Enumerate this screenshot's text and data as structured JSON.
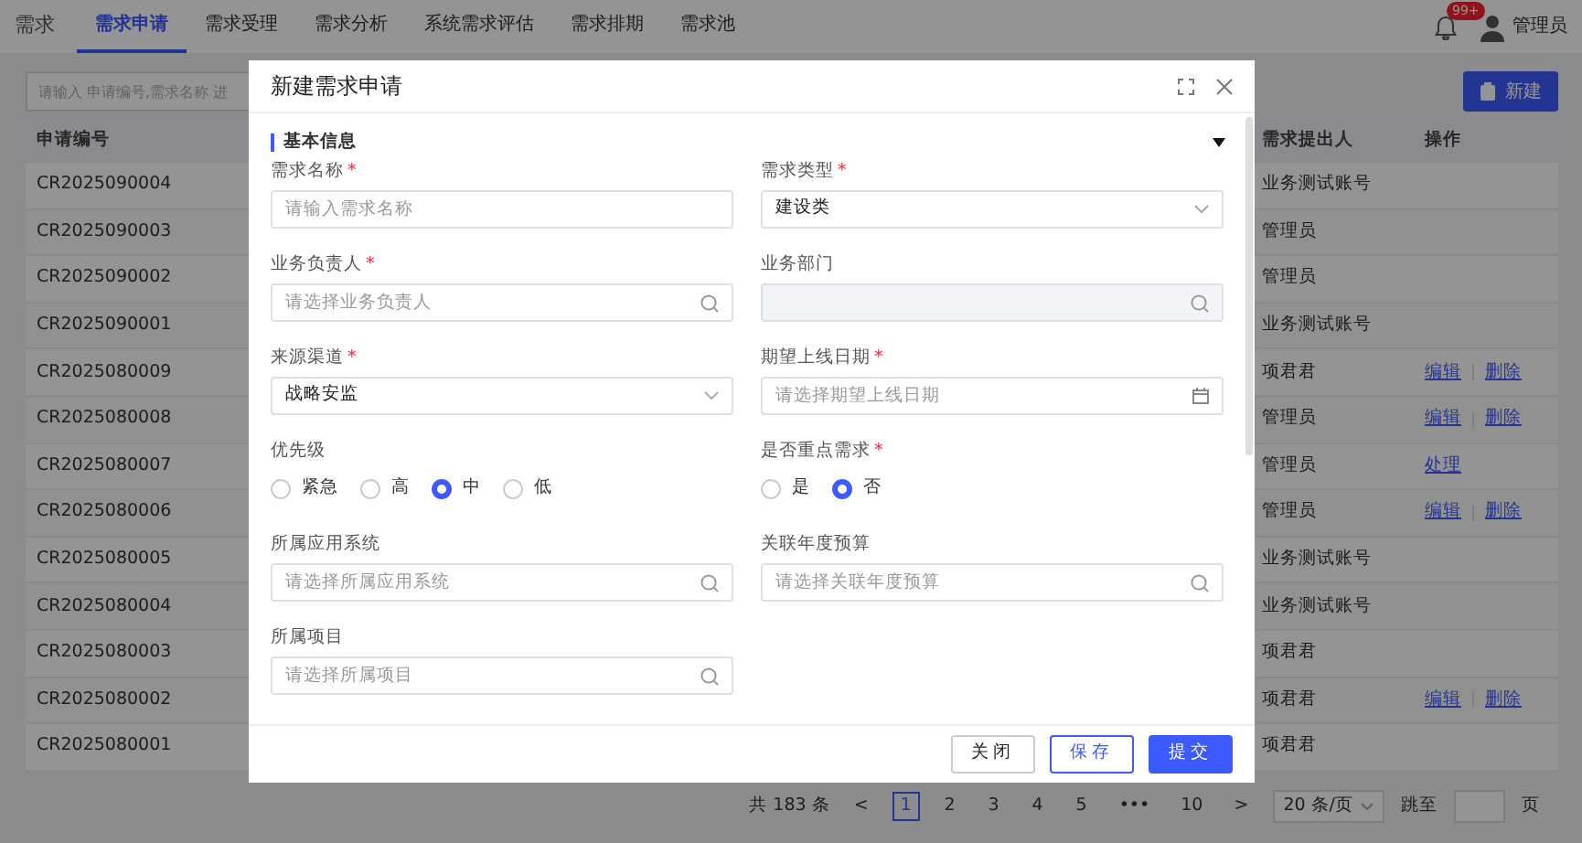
{
  "nav": {
    "brand": "需求",
    "tabs": [
      {
        "label": "需求申请",
        "selected": true
      },
      {
        "label": "需求受理",
        "selected": false
      },
      {
        "label": "需求分析",
        "selected": false
      },
      {
        "label": "系统需求评估",
        "selected": false
      },
      {
        "label": "需求排期",
        "selected": false
      },
      {
        "label": "需求池",
        "selected": false
      }
    ],
    "notification_badge": "99+",
    "user": "管理员"
  },
  "toolbar": {
    "search_placeholder": "请输入 申请编号,需求名称 进",
    "new_button": "新建"
  },
  "table": {
    "columns": [
      "申请编号",
      "需求提出人",
      "操作"
    ],
    "rows": [
      {
        "id": "CR2025090004",
        "proposer": "业务测试账号",
        "actions": []
      },
      {
        "id": "CR2025090003",
        "proposer": "管理员",
        "actions": []
      },
      {
        "id": "CR2025090002",
        "proposer": "管理员",
        "actions": []
      },
      {
        "id": "CR2025090001",
        "proposer": "业务测试账号",
        "actions": []
      },
      {
        "id": "CR2025080009",
        "proposer": "项君君",
        "actions": [
          "编辑",
          "删除"
        ]
      },
      {
        "id": "CR2025080008",
        "proposer": "管理员",
        "actions": [
          "编辑",
          "删除"
        ]
      },
      {
        "id": "CR2025080007",
        "proposer": "管理员",
        "actions": [
          "处理"
        ]
      },
      {
        "id": "CR2025080006",
        "proposer": "管理员",
        "actions": [
          "编辑",
          "删除"
        ]
      },
      {
        "id": "CR2025080005",
        "proposer": "业务测试账号",
        "actions": []
      },
      {
        "id": "CR2025080004",
        "proposer": "业务测试账号",
        "actions": []
      },
      {
        "id": "CR2025080003",
        "proposer": "项君君",
        "actions": []
      },
      {
        "id": "CR2025080002",
        "proposer": "项君君",
        "actions": [
          "编辑",
          "删除"
        ]
      },
      {
        "id": "CR2025080001",
        "proposer": "项君君",
        "actions": []
      }
    ]
  },
  "pagination": {
    "total": "共 183 条",
    "prev": "<",
    "pages": [
      {
        "label": "1",
        "selected": true
      },
      {
        "label": "2",
        "selected": false
      },
      {
        "label": "3",
        "selected": false
      },
      {
        "label": "4",
        "selected": false
      },
      {
        "label": "5",
        "selected": false
      },
      {
        "label": "•••",
        "selected": false
      },
      {
        "label": "10",
        "selected": false
      }
    ],
    "next": ">",
    "page_size": "20 条/页",
    "jump_label": "跳至",
    "page_suffix": "页"
  },
  "modal": {
    "title": "新建需求申请",
    "required_symbol": "*",
    "section": {
      "title": "基本信息",
      "expanded": true
    },
    "fields": [
      {
        "label": "需求名称",
        "required": true,
        "kind": "input",
        "placeholder": "请输入需求名称"
      },
      {
        "label": "需求类型",
        "required": true,
        "kind": "select",
        "value": "建设类"
      },
      {
        "label": "业务负责人",
        "required": true,
        "kind": "search",
        "placeholder": "请选择业务负责人"
      },
      {
        "label": "业务部门",
        "required": false,
        "kind": "search",
        "disabled": true
      },
      {
        "label": "来源渠道",
        "required": true,
        "kind": "select",
        "value": "战略安监"
      },
      {
        "label": "期望上线日期",
        "required": true,
        "kind": "date",
        "placeholder": "请选择期望上线日期"
      },
      {
        "label": "优先级",
        "required": false,
        "kind": "radio",
        "options": [
          {
            "label": "紧急",
            "selected": false
          },
          {
            "label": "高",
            "selected": false
          },
          {
            "label": "中",
            "selected": true
          },
          {
            "label": "低",
            "selected": false
          }
        ]
      },
      {
        "label": "是否重点需求",
        "required": true,
        "kind": "radio",
        "options": [
          {
            "label": "是",
            "selected": false
          },
          {
            "label": "否",
            "selected": true
          }
        ]
      },
      {
        "label": "所属应用系统",
        "required": false,
        "kind": "search",
        "placeholder": "请选择所属应用系统"
      },
      {
        "label": "关联年度预算",
        "required": false,
        "kind": "search",
        "placeholder": "请选择关联年度预算"
      },
      {
        "label": "所属项目",
        "required": false,
        "kind": "search",
        "placeholder": "请选择所属项目"
      }
    ],
    "buttons": [
      {
        "label": "关闭",
        "kind": "default"
      },
      {
        "label": "保存",
        "kind": "outline"
      },
      {
        "label": "提交",
        "kind": "primary"
      }
    ]
  }
}
